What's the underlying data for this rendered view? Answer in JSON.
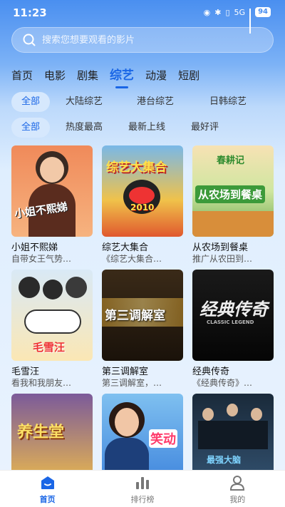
{
  "status_bar": {
    "time": "11:23",
    "network": "5G",
    "battery": "94"
  },
  "search": {
    "placeholder": "搜索您想要观看的影片"
  },
  "main_tabs": [
    {
      "label": "首页"
    },
    {
      "label": "电影"
    },
    {
      "label": "剧集"
    },
    {
      "label": "综艺",
      "active": true
    },
    {
      "label": "动漫"
    },
    {
      "label": "短剧"
    }
  ],
  "region_filters": [
    {
      "label": "全部",
      "active": true
    },
    {
      "label": "大陆综艺"
    },
    {
      "label": "港台综艺"
    },
    {
      "label": "日韩综艺"
    }
  ],
  "sort_filters": [
    {
      "label": "全部",
      "active": true
    },
    {
      "label": "热度最高"
    },
    {
      "label": "最新上线"
    },
    {
      "label": "最好评"
    }
  ],
  "shows": [
    {
      "title": "小姐不熙娣",
      "desc": "自带女王气势…",
      "poster_text": "小姐不熙娣"
    },
    {
      "title": "综艺大集合",
      "desc": "《综艺大集合…",
      "poster_text": "综艺大集合",
      "poster_sub": "2010"
    },
    {
      "title": "从农场到餐桌",
      "desc": "推广从农田到…",
      "poster_text": "从农场到餐桌",
      "poster_sub": "春耕记"
    },
    {
      "title": "毛雪汪",
      "desc": "看我和我朋友…",
      "poster_text": "毛雪汪"
    },
    {
      "title": "第三调解室",
      "desc": "第三调解室，…",
      "poster_text": "第三调解室"
    },
    {
      "title": "经典传奇",
      "desc": "《经典传奇》…",
      "poster_text": "经典传奇",
      "poster_sub": "CLASSIC LEGEND"
    },
    {
      "title": "",
      "desc": "",
      "poster_text": "养生堂"
    },
    {
      "title": "",
      "desc": "",
      "poster_text": "笑动"
    },
    {
      "title": "",
      "desc": "",
      "poster_text": "最强大脑"
    }
  ],
  "bottom_nav": [
    {
      "label": "首页",
      "icon": "home-icon",
      "active": true
    },
    {
      "label": "排行榜",
      "icon": "ranking-icon"
    },
    {
      "label": "我的",
      "icon": "profile-icon"
    }
  ],
  "colors": {
    "accent": "#1a66e6",
    "header_blue": "#4a8ff0"
  }
}
